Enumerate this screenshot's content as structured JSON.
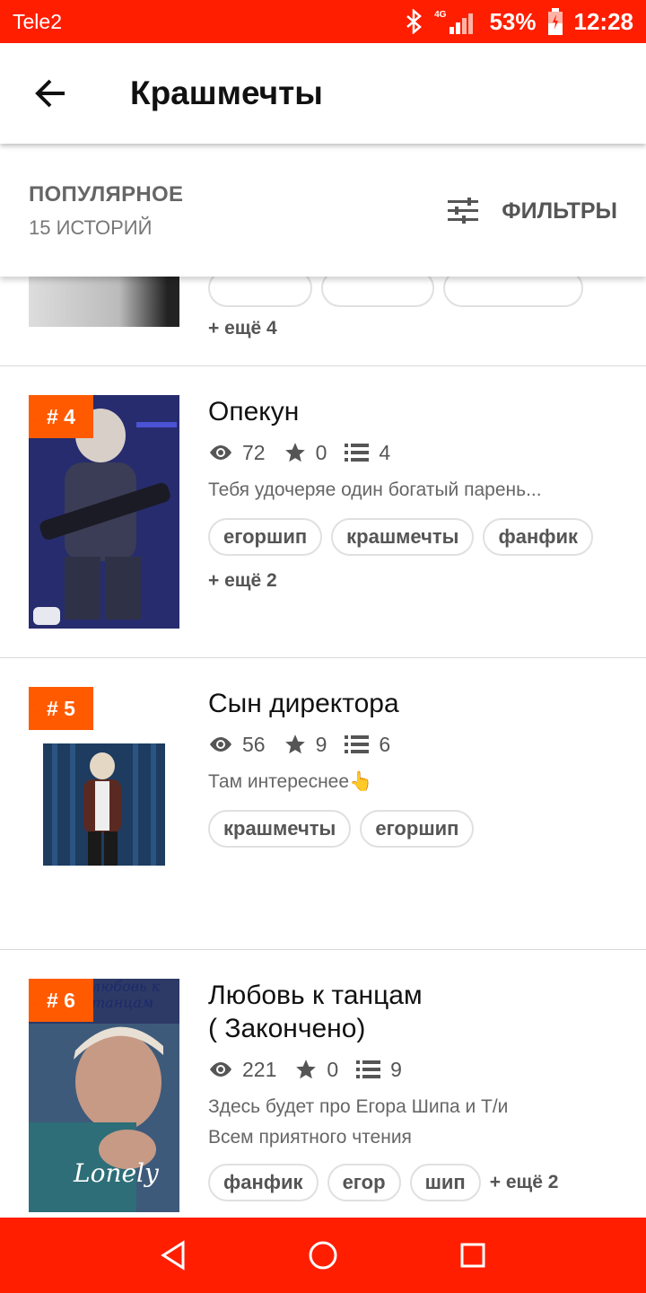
{
  "status": {
    "carrier": "Tele2",
    "network": "4G",
    "battery": "53%",
    "time": "12:28"
  },
  "app_bar": {
    "title": "Крашмечты"
  },
  "sort": {
    "title": "ПОПУЛЯРНОЕ",
    "count": "15 ИСТОРИЙ",
    "filters_label": "ФИЛЬТРЫ"
  },
  "partial_story": {
    "more": "+ ещё 4"
  },
  "stories": [
    {
      "rank": "# 4",
      "title": "Опекун",
      "views": "72",
      "stars": "0",
      "parts": "4",
      "description": "Тебя удочеряе один богатый парень...",
      "tags": [
        "егоршип",
        "крашмечты",
        "фанфик"
      ],
      "more": "+ ещё 2"
    },
    {
      "rank": "# 5",
      "title": "Сын директора",
      "views": "56",
      "stars": "9",
      "parts": "6",
      "description": "Там интереснее👆",
      "tags": [
        "крашмечты",
        "егоршип"
      ]
    },
    {
      "rank": "# 6",
      "title_line1": "Любовь к танцам",
      "title_line2": "( Закончено)",
      "views": "221",
      "stars": "0",
      "parts": "9",
      "description_line1": "Здесь будет про Егора Шипа и Т/и",
      "description_line2": "Всем приятного чтения",
      "tags": [
        "фанфик",
        "егор",
        "шип"
      ],
      "more": "+ ещё 2",
      "cover_text_top": "любовь к танцам",
      "cover_text_bottom": "Lonely"
    }
  ],
  "colors": {
    "status_bar": "#ff1e00",
    "rank_badge": "#ff5a00",
    "nav_bar": "#ff1e00"
  },
  "icons": {
    "back": "arrow-left-icon",
    "filters": "sliders-icon",
    "views": "eye-icon",
    "stars": "star-icon",
    "parts": "list-icon",
    "nav": [
      "back-triangle-icon",
      "home-circle-icon",
      "recents-square-icon"
    ]
  }
}
